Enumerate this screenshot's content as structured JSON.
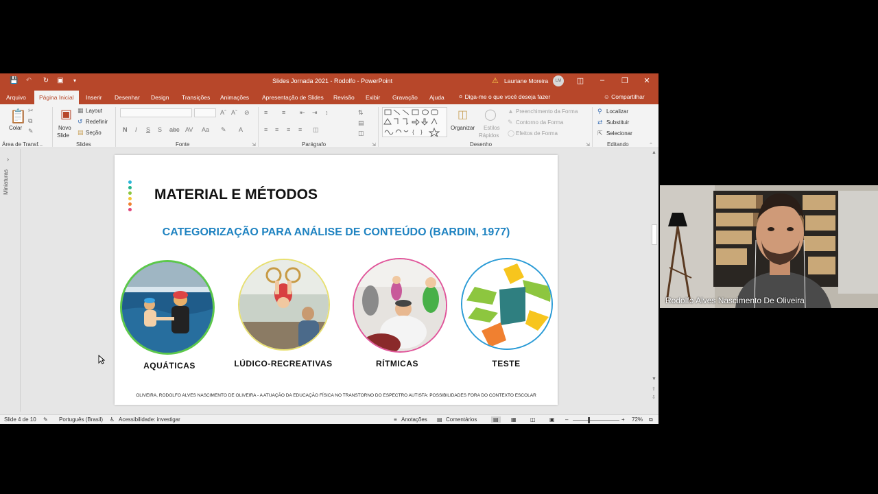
{
  "window": {
    "title": "Slides Jornada 2021 - Rodolfo  -  PowerPoint",
    "user_name": "Lauriane Moreira",
    "user_initials": "LM"
  },
  "tabs": [
    "Arquivo",
    "Página Inicial",
    "Inserir",
    "Desenhar",
    "Design",
    "Transições",
    "Animações",
    "Apresentação de Slides",
    "Revisão",
    "Exibir",
    "Gravação",
    "Ajuda"
  ],
  "active_tab": "Página Inicial",
  "tell_me": "Diga-me o que você deseja fazer",
  "share": "Compartilhar",
  "ribbon": {
    "clipboard": {
      "paste": "Colar",
      "label": "Área de Transf..."
    },
    "slides": {
      "new_slide_1": "Novo",
      "new_slide_2": "Slide",
      "layout": "Layout",
      "reset": "Redefinir",
      "section": "Seção",
      "label": "Slides"
    },
    "font": {
      "label": "Fonte"
    },
    "paragraph": {
      "label": "Parágrafo"
    },
    "drawing": {
      "arrange": "Organizar",
      "quick_styles_1": "Estilos",
      "quick_styles_2": "Rápidos",
      "fill": "Preenchimento da Forma",
      "outline": "Contorno da Forma",
      "effects": "Efeitos de Forma",
      "label": "Desenho"
    },
    "editing": {
      "find": "Localizar",
      "replace": "Substituir",
      "select": "Selecionar",
      "label": "Editando"
    }
  },
  "rail": {
    "label": "Miniaturas"
  },
  "slide": {
    "title": "MATERIAL E MÉTODOS",
    "subtitle": "CATEGORIZAÇÃO PARA ANÁLISE DE CONTEÚDO (BARDIN, 1977)",
    "categories": [
      "AQUÁTICAS",
      "LÚDICO-RECREATIVAS",
      "RÍTMICAS",
      "TESTE"
    ],
    "footer": "OLIVEIRA, RODOLFO ALVES NASCIMENTO DE OLIVEIRA - A ATUAÇÃO DA EDUCAÇÃO FÍSICA NO TRANSTORNO DO ESPECTRO AUTISTA: POSSIBILIDADES FORA DO CONTEXTO ESCOLAR",
    "dot_colors": [
      "#2ab6d9",
      "#1fb389",
      "#8dc63f",
      "#f4c430",
      "#f08030",
      "#e0457b"
    ],
    "circle_border_colors": [
      "#5cc84a",
      "#e8e070",
      "#e0559a",
      "#2a9bd6"
    ]
  },
  "status": {
    "slide_of": "Slide 4 de 10",
    "language": "Português (Brasil)",
    "accessibility": "Acessibilidade: investigar",
    "notes": "Anotações",
    "comments": "Comentários",
    "zoom": "72%"
  },
  "webcam": {
    "name": "Rodolfo Alves Nascimento De Oliveira"
  }
}
